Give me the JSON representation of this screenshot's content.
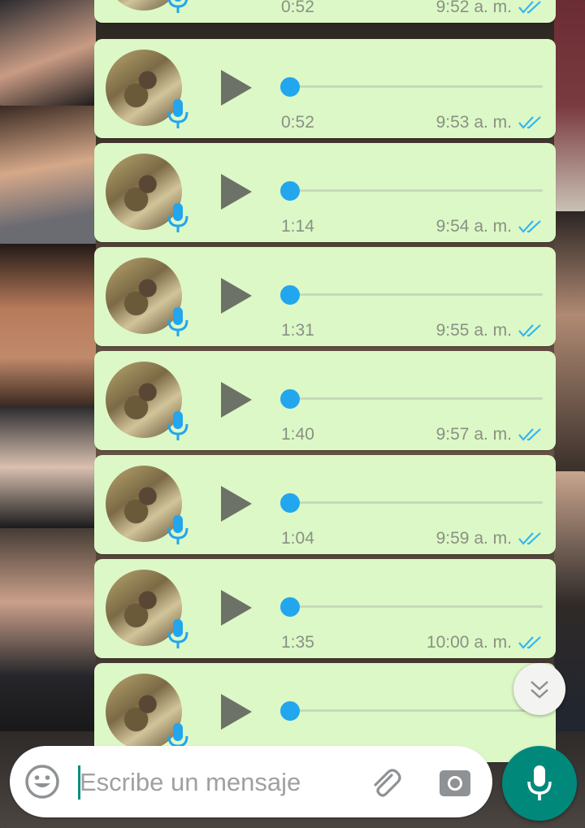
{
  "colors": {
    "bubble_bg": "#dcf8c6",
    "accent_blue": "#22a6ee",
    "fab_green": "#00897b",
    "meta_text": "#8a9184"
  },
  "messages": [
    {
      "duration": "0:52",
      "time": "9:52 a. m.",
      "status": "read",
      "progress": 0
    },
    {
      "duration": "0:52",
      "time": "9:53 a. m.",
      "status": "read",
      "progress": 0
    },
    {
      "duration": "1:14",
      "time": "9:54 a. m.",
      "status": "read",
      "progress": 0
    },
    {
      "duration": "1:31",
      "time": "9:55 a. m.",
      "status": "read",
      "progress": 0
    },
    {
      "duration": "1:40",
      "time": "9:57 a. m.",
      "status": "read",
      "progress": 0
    },
    {
      "duration": "1:04",
      "time": "9:59 a. m.",
      "status": "read",
      "progress": 0
    },
    {
      "duration": "1:35",
      "time": "10:00 a. m.",
      "status": "read",
      "progress": 0
    },
    {
      "duration": "",
      "time": "",
      "status": "",
      "progress": 0
    }
  ],
  "composer": {
    "placeholder": "Escribe un mensaje",
    "value": "",
    "icons": [
      "emoji-icon",
      "paperclip-icon",
      "camera-icon",
      "microphone-icon"
    ]
  },
  "scroll_button": {
    "icon": "double-chevron-down-icon"
  }
}
